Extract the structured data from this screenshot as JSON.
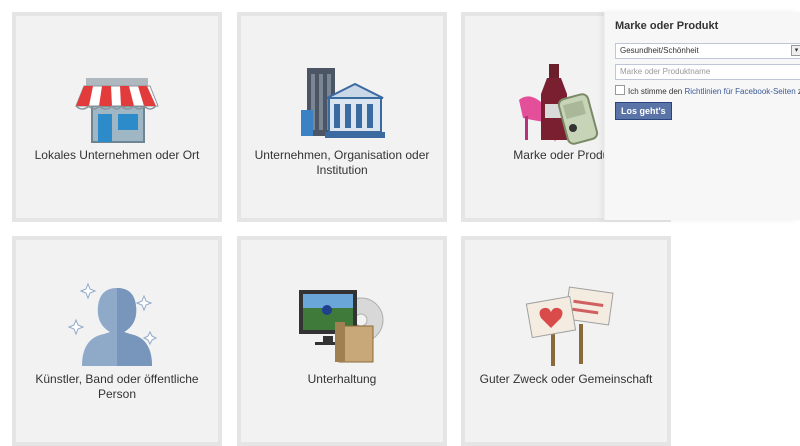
{
  "tiles": [
    {
      "label": "Lokales Unternehmen oder Ort",
      "icon": "store-awning-icon"
    },
    {
      "label": "Unternehmen, Organisation oder Institution",
      "icon": "office-buildings-icon"
    },
    {
      "label": "Marke oder Produkt",
      "icon": "products-icon"
    },
    {
      "label": "Künstler, Band oder öffentliche Person",
      "icon": "person-silhouette-icon"
    },
    {
      "label": "Unterhaltung",
      "icon": "tv-media-icon"
    },
    {
      "label": "Guter Zweck oder Gemeinschaft",
      "icon": "protest-signs-icon"
    }
  ],
  "popup": {
    "title": "Marke oder Produkt",
    "category_selected": "Gesundheit/Schönheit",
    "name_placeholder": "Marke oder Produktname",
    "agree_prefix": "Ich stimme den ",
    "agree_link": "Richtlinien für Facebook-Seiten",
    "agree_suffix": " zu",
    "submit_label": "Los geht's"
  },
  "colors": {
    "tile_bg": "#f2f2f2",
    "tile_border": "#e5e5e5",
    "link": "#3b5998",
    "button": "#5b74a8"
  }
}
